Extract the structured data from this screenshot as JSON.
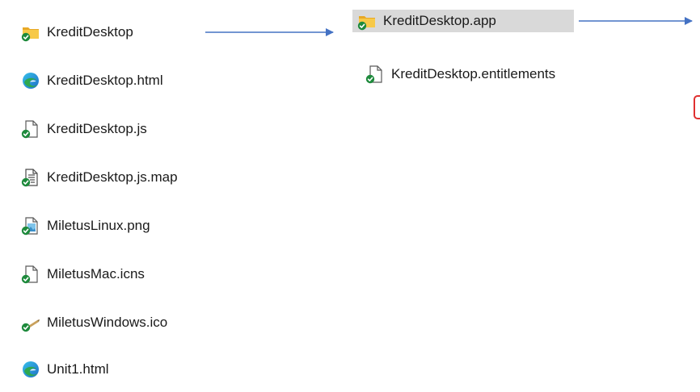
{
  "left_column": [
    {
      "name": "KreditDesktop",
      "icon": "folder-icon"
    },
    {
      "name": "KreditDesktop.html",
      "icon": "edge-html-icon"
    },
    {
      "name": "KreditDesktop.js",
      "icon": "file-icon"
    },
    {
      "name": "KreditDesktop.js.map",
      "icon": "text-file-icon"
    },
    {
      "name": "MiletusLinux.png",
      "icon": "image-file-icon"
    },
    {
      "name": "MiletusMac.icns",
      "icon": "file-icon"
    },
    {
      "name": "MiletusWindows.ico",
      "icon": "ico-file-icon"
    },
    {
      "name": "Unit1.html",
      "icon": "edge-html-icon"
    }
  ],
  "right_column": [
    {
      "name": "KreditDesktop.app",
      "icon": "folder-icon",
      "selected": true
    },
    {
      "name": "KreditDesktop.entitlements",
      "icon": "file-icon",
      "selected": false
    }
  ],
  "colors": {
    "arrow": "#4472c4",
    "selection": "#d9d9d9",
    "sync_badge": "#1e8a3c",
    "folder": "#f5c542",
    "annotation_box": "#e03030"
  }
}
